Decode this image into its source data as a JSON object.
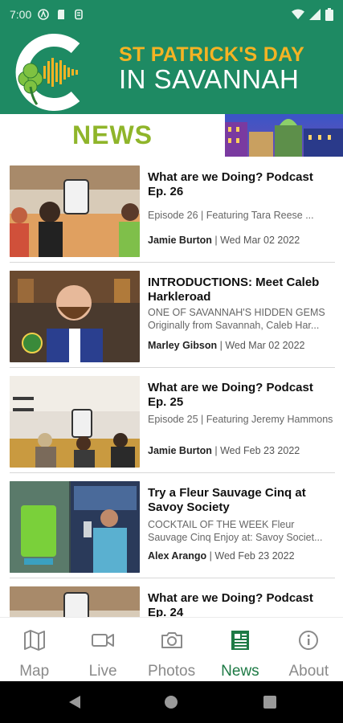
{
  "status_bar": {
    "time": "7:00"
  },
  "banner": {
    "title_line1": "ST PATRICK'S DAY",
    "title_line2": "IN SAVANNAH"
  },
  "news_section": {
    "heading": "NEWS"
  },
  "articles": [
    {
      "title": "What are we Doing? Podcast Ep. 26",
      "excerpt": "Episode 26 | Featuring Tara Reese ...",
      "author": "Jamie Burton",
      "date": "Wed Mar 02 2022"
    },
    {
      "title": "INTRODUCTIONS: Meet Caleb Harkleroad",
      "excerpt": "ONE OF SAVANNAH'S HIDDEN GEMS Originally from Savannah, Caleb Har...",
      "author": "Marley Gibson",
      "date": "Wed Mar 02 2022"
    },
    {
      "title": "What are we Doing? Podcast Ep. 25",
      "excerpt": "Episode 25 | Featuring Jeremy Hammons",
      "author": "Jamie Burton",
      "date": "Wed Feb 23 2022"
    },
    {
      "title": "Try a Fleur Sauvage Cinq at Savoy Society",
      "excerpt": "COCKTAIL OF THE WEEK  Fleur Sauvage Cinq  Enjoy at: Savoy Societ...",
      "author": "Alex Arango",
      "date": "Wed Feb 23 2022"
    },
    {
      "title": "What are we Doing? Podcast Ep. 24",
      "excerpt": "",
      "author": "",
      "date": ""
    }
  ],
  "meta_separator": " | ",
  "bottom_nav": [
    {
      "label": "Map",
      "icon": "map-icon",
      "active": false
    },
    {
      "label": "Live",
      "icon": "video-camera-icon",
      "active": false
    },
    {
      "label": "Photos",
      "icon": "camera-icon",
      "active": false
    },
    {
      "label": "News",
      "icon": "newspaper-icon",
      "active": true
    },
    {
      "label": "About",
      "icon": "info-icon",
      "active": false
    }
  ],
  "colors": {
    "brand_green": "#1e8a63",
    "news_green": "#8fb52a",
    "gold": "#f4b324",
    "active_nav": "#1e7a45"
  }
}
